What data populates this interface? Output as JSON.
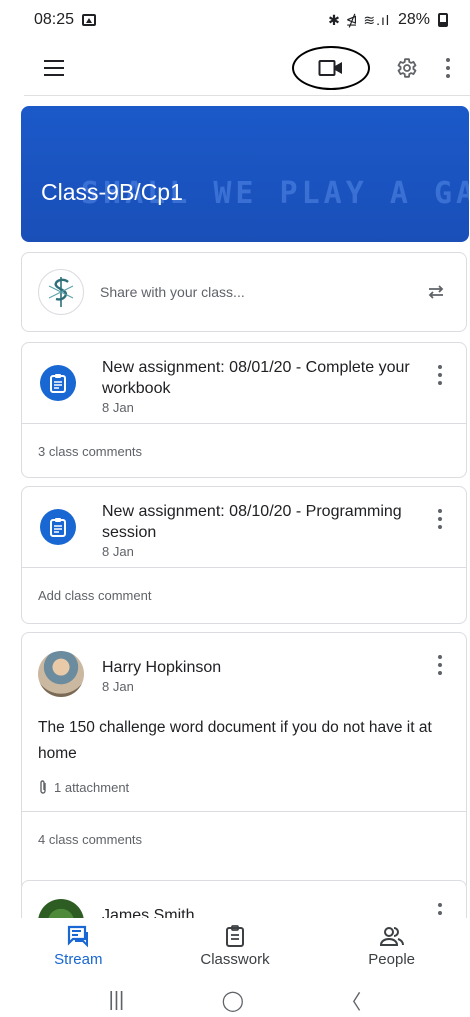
{
  "status_bar": {
    "time": "08:25",
    "signal_icons": "✱ ⋬ ≋.ıl",
    "battery_pct": "28%"
  },
  "app_bar": {
    "menu_icon": "hamburger-icon",
    "video_icon": "video-camera-icon",
    "settings_icon": "gear-icon",
    "more_icon": "more-vertical-icon"
  },
  "banner": {
    "title": "Class-9B/Cp1",
    "pattern_text": "SHALL WE PLAY A GAME",
    "color": "#1b59c9"
  },
  "share": {
    "placeholder": "Share with your class..."
  },
  "posts": [
    {
      "title": "New assignment: 08/01/20 - Complete your workbook",
      "date": "8 Jan",
      "footer": "3 class comments"
    },
    {
      "title": "New assignment: 08/10/20 - Programming session",
      "date": "8 Jan",
      "footer": "Add class comment"
    },
    {
      "author": "Harry Hopkinson",
      "date": "8 Jan",
      "body": "The 150 challenge word document if you do not have it at home",
      "attachment": "1 attachment",
      "footer": "4 class comments"
    },
    {
      "author": "James Smith"
    }
  ],
  "bottom_nav": {
    "stream": "Stream",
    "classwork": "Classwork",
    "people": "People",
    "active_color": "#1967d2"
  },
  "system_nav": {
    "recents": "|||",
    "home": "◯",
    "back": "〈"
  }
}
